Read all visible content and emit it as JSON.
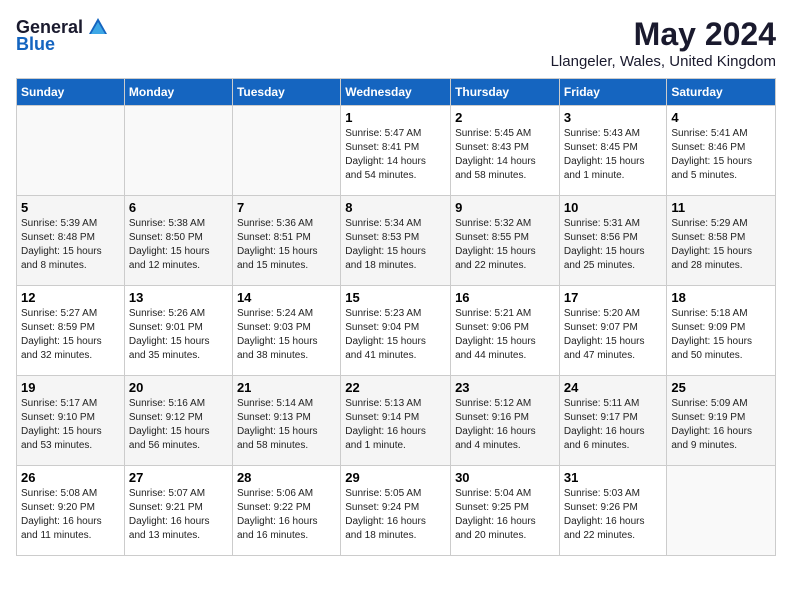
{
  "logo": {
    "general": "General",
    "blue": "Blue"
  },
  "title": "May 2024",
  "location": "Llangeler, Wales, United Kingdom",
  "headers": [
    "Sunday",
    "Monday",
    "Tuesday",
    "Wednesday",
    "Thursday",
    "Friday",
    "Saturday"
  ],
  "weeks": [
    [
      {
        "day": "",
        "info": ""
      },
      {
        "day": "",
        "info": ""
      },
      {
        "day": "",
        "info": ""
      },
      {
        "day": "1",
        "info": "Sunrise: 5:47 AM\nSunset: 8:41 PM\nDaylight: 14 hours\nand 54 minutes."
      },
      {
        "day": "2",
        "info": "Sunrise: 5:45 AM\nSunset: 8:43 PM\nDaylight: 14 hours\nand 58 minutes."
      },
      {
        "day": "3",
        "info": "Sunrise: 5:43 AM\nSunset: 8:45 PM\nDaylight: 15 hours\nand 1 minute."
      },
      {
        "day": "4",
        "info": "Sunrise: 5:41 AM\nSunset: 8:46 PM\nDaylight: 15 hours\nand 5 minutes."
      }
    ],
    [
      {
        "day": "5",
        "info": "Sunrise: 5:39 AM\nSunset: 8:48 PM\nDaylight: 15 hours\nand 8 minutes."
      },
      {
        "day": "6",
        "info": "Sunrise: 5:38 AM\nSunset: 8:50 PM\nDaylight: 15 hours\nand 12 minutes."
      },
      {
        "day": "7",
        "info": "Sunrise: 5:36 AM\nSunset: 8:51 PM\nDaylight: 15 hours\nand 15 minutes."
      },
      {
        "day": "8",
        "info": "Sunrise: 5:34 AM\nSunset: 8:53 PM\nDaylight: 15 hours\nand 18 minutes."
      },
      {
        "day": "9",
        "info": "Sunrise: 5:32 AM\nSunset: 8:55 PM\nDaylight: 15 hours\nand 22 minutes."
      },
      {
        "day": "10",
        "info": "Sunrise: 5:31 AM\nSunset: 8:56 PM\nDaylight: 15 hours\nand 25 minutes."
      },
      {
        "day": "11",
        "info": "Sunrise: 5:29 AM\nSunset: 8:58 PM\nDaylight: 15 hours\nand 28 minutes."
      }
    ],
    [
      {
        "day": "12",
        "info": "Sunrise: 5:27 AM\nSunset: 8:59 PM\nDaylight: 15 hours\nand 32 minutes."
      },
      {
        "day": "13",
        "info": "Sunrise: 5:26 AM\nSunset: 9:01 PM\nDaylight: 15 hours\nand 35 minutes."
      },
      {
        "day": "14",
        "info": "Sunrise: 5:24 AM\nSunset: 9:03 PM\nDaylight: 15 hours\nand 38 minutes."
      },
      {
        "day": "15",
        "info": "Sunrise: 5:23 AM\nSunset: 9:04 PM\nDaylight: 15 hours\nand 41 minutes."
      },
      {
        "day": "16",
        "info": "Sunrise: 5:21 AM\nSunset: 9:06 PM\nDaylight: 15 hours\nand 44 minutes."
      },
      {
        "day": "17",
        "info": "Sunrise: 5:20 AM\nSunset: 9:07 PM\nDaylight: 15 hours\nand 47 minutes."
      },
      {
        "day": "18",
        "info": "Sunrise: 5:18 AM\nSunset: 9:09 PM\nDaylight: 15 hours\nand 50 minutes."
      }
    ],
    [
      {
        "day": "19",
        "info": "Sunrise: 5:17 AM\nSunset: 9:10 PM\nDaylight: 15 hours\nand 53 minutes."
      },
      {
        "day": "20",
        "info": "Sunrise: 5:16 AM\nSunset: 9:12 PM\nDaylight: 15 hours\nand 56 minutes."
      },
      {
        "day": "21",
        "info": "Sunrise: 5:14 AM\nSunset: 9:13 PM\nDaylight: 15 hours\nand 58 minutes."
      },
      {
        "day": "22",
        "info": "Sunrise: 5:13 AM\nSunset: 9:14 PM\nDaylight: 16 hours\nand 1 minute."
      },
      {
        "day": "23",
        "info": "Sunrise: 5:12 AM\nSunset: 9:16 PM\nDaylight: 16 hours\nand 4 minutes."
      },
      {
        "day": "24",
        "info": "Sunrise: 5:11 AM\nSunset: 9:17 PM\nDaylight: 16 hours\nand 6 minutes."
      },
      {
        "day": "25",
        "info": "Sunrise: 5:09 AM\nSunset: 9:19 PM\nDaylight: 16 hours\nand 9 minutes."
      }
    ],
    [
      {
        "day": "26",
        "info": "Sunrise: 5:08 AM\nSunset: 9:20 PM\nDaylight: 16 hours\nand 11 minutes."
      },
      {
        "day": "27",
        "info": "Sunrise: 5:07 AM\nSunset: 9:21 PM\nDaylight: 16 hours\nand 13 minutes."
      },
      {
        "day": "28",
        "info": "Sunrise: 5:06 AM\nSunset: 9:22 PM\nDaylight: 16 hours\nand 16 minutes."
      },
      {
        "day": "29",
        "info": "Sunrise: 5:05 AM\nSunset: 9:24 PM\nDaylight: 16 hours\nand 18 minutes."
      },
      {
        "day": "30",
        "info": "Sunrise: 5:04 AM\nSunset: 9:25 PM\nDaylight: 16 hours\nand 20 minutes."
      },
      {
        "day": "31",
        "info": "Sunrise: 5:03 AM\nSunset: 9:26 PM\nDaylight: 16 hours\nand 22 minutes."
      },
      {
        "day": "",
        "info": ""
      }
    ]
  ]
}
